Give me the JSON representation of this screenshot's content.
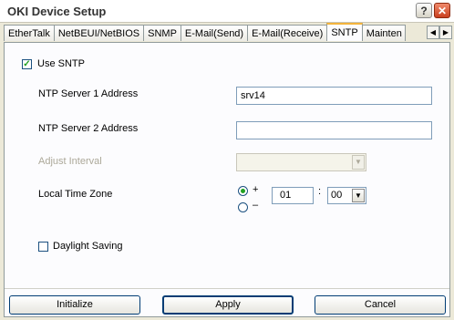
{
  "window": {
    "title": "OKI Device Setup",
    "help_label": "?",
    "close_label": "✕"
  },
  "tabs": [
    {
      "label": "EtherTalk",
      "active": false
    },
    {
      "label": "NetBEUI/NetBIOS",
      "active": false
    },
    {
      "label": "SNMP",
      "active": false
    },
    {
      "label": "E-Mail(Send)",
      "active": false
    },
    {
      "label": "E-Mail(Receive)",
      "active": false
    },
    {
      "label": "SNTP",
      "active": true
    },
    {
      "label": "Mainten",
      "active": false
    }
  ],
  "tab_scroll": {
    "left": "◀",
    "right": "▶"
  },
  "form": {
    "use_sntp": {
      "label": "Use SNTP",
      "checked": true,
      "mark": "✓"
    },
    "ntp1": {
      "label": "NTP Server 1 Address",
      "value": "srv14"
    },
    "ntp2": {
      "label": "NTP Server 2 Address",
      "value": ""
    },
    "adjust_interval": {
      "label": "Adjust Interval",
      "value": "",
      "arrow": "▼"
    },
    "timezone": {
      "label": "Local Time Zone",
      "plus": "+",
      "minus": "–",
      "selected": "+",
      "hours": "01",
      "separator": ":",
      "minutes": "00",
      "arrow": "▼"
    },
    "daylight_saving": {
      "label": "Daylight Saving",
      "checked": false
    }
  },
  "buttons": {
    "initialize": "Initialize",
    "apply": "Apply",
    "cancel": "Cancel"
  }
}
